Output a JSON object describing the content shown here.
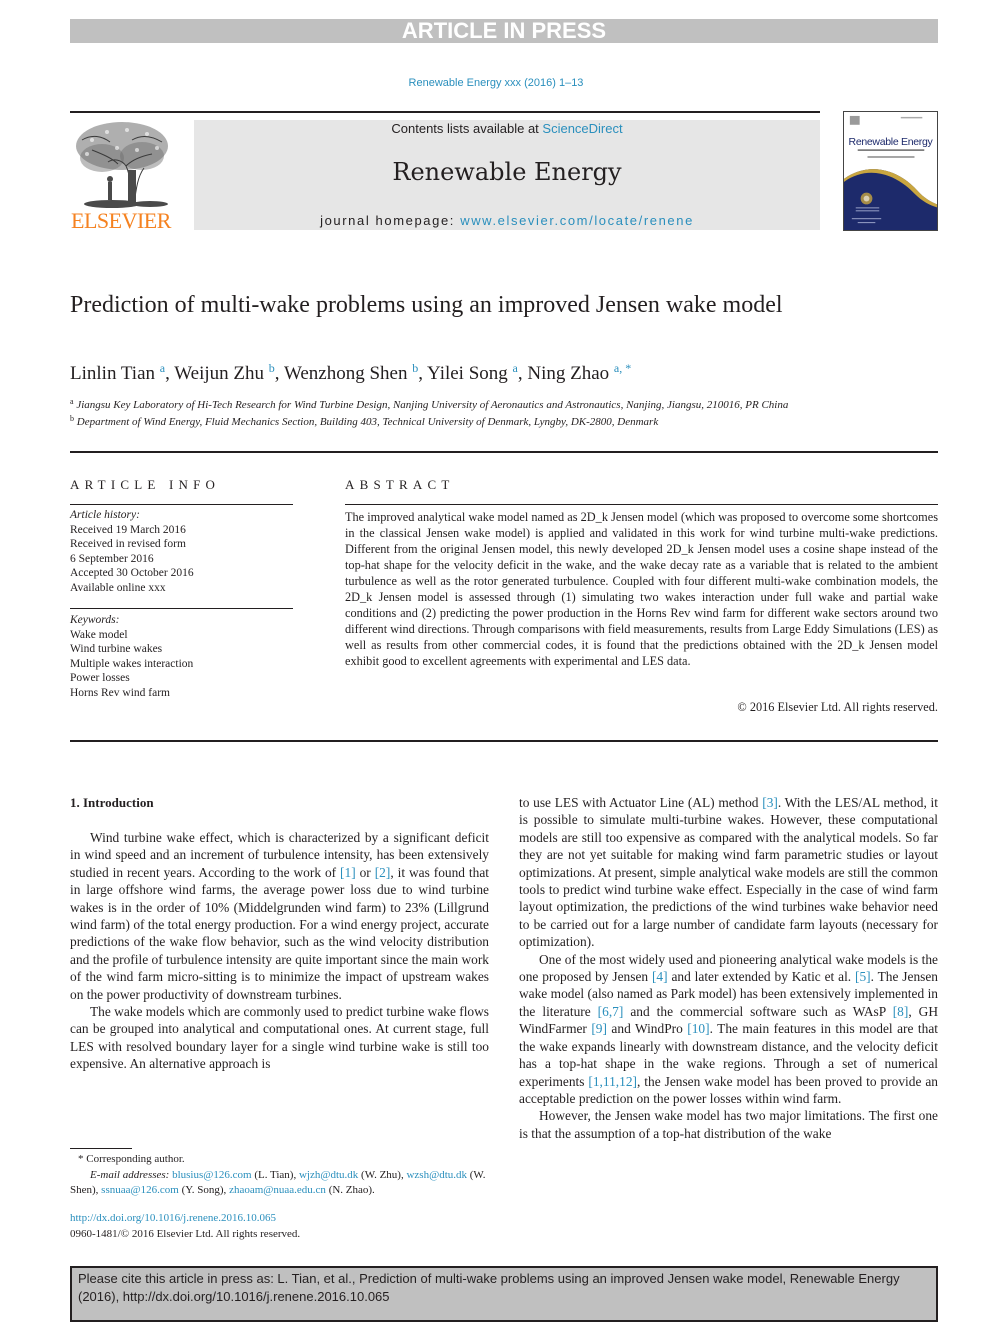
{
  "banner": "ARTICLE IN PRESS",
  "journal_ref": "Renewable Energy xxx (2016) 1–13",
  "masthead": {
    "contents_prefix": "Contents lists available at ",
    "contents_link": "ScienceDirect",
    "journal_name": "Renewable Energy",
    "homepage_prefix": "journal homepage: ",
    "homepage_link": "www.elsevier.com/locate/renene"
  },
  "publisher_logo": "ELSEVIER",
  "cover": {
    "title": "Renewable Energy",
    "subtitle": "AN INTERNATIONAL JOURNAL",
    "colors": {
      "navy": "#1d2a6b",
      "gold": "#c9a640"
    }
  },
  "article": {
    "title": "Prediction of multi-wake problems using an improved Jensen wake model",
    "authors": [
      {
        "name": "Linlin Tian",
        "affil": "a"
      },
      {
        "name": "Weijun Zhu",
        "affil": "b"
      },
      {
        "name": "Wenzhong Shen",
        "affil": "b"
      },
      {
        "name": "Yilei Song",
        "affil": "a"
      },
      {
        "name": "Ning Zhao",
        "affil": "a, *"
      }
    ],
    "affiliations": [
      {
        "mark": "a",
        "text": "Jiangsu Key Laboratory of Hi-Tech Research for Wind Turbine Design, Nanjing University of Aeronautics and Astronautics, Nanjing, Jiangsu, 210016, PR China"
      },
      {
        "mark": "b",
        "text": "Department of Wind Energy, Fluid Mechanics Section, Building 403, Technical University of Denmark, Lyngby, DK-2800, Denmark"
      }
    ]
  },
  "article_info": {
    "heading": "ARTICLE INFO",
    "history_label": "Article history:",
    "history": [
      "Received 19 March 2016",
      "Received in revised form",
      "6 September 2016",
      "Accepted 30 October 2016",
      "Available online xxx"
    ],
    "keywords_label": "Keywords:",
    "keywords": [
      "Wake model",
      "Wind turbine wakes",
      "Multiple wakes interaction",
      "Power losses",
      "Horns Rev wind farm"
    ]
  },
  "abstract": {
    "heading": "ABSTRACT",
    "text": "The improved analytical wake model named as 2D_k Jensen model (which was proposed to overcome some shortcomes in the classical Jensen wake model) is applied and validated in this work for wind turbine multi-wake predictions. Different from the original Jensen model, this newly developed 2D_k Jensen model uses a cosine shape instead of the top-hat shape for the velocity deficit in the wake, and the wake decay rate as a variable that is related to the ambient turbulence as well as the rotor generated turbulence. Coupled with four different multi-wake combination models, the 2D_k Jensen model is assessed through (1) simulating two wakes interaction under full wake and partial wake conditions and (2) predicting the power production in the Horns Rev wind farm for different wake sectors around two different wind directions. Through comparisons with field measurements, results from Large Eddy Simulations (LES) as well as results from other commercial codes, it is found that the predictions obtained with the 2D_k Jensen model exhibit good to excellent agreements with experimental and LES data.",
    "copyright": "© 2016 Elsevier Ltd. All rights reserved."
  },
  "body": {
    "section_heading": "1.  Introduction",
    "left": {
      "p1": [
        {
          "t": "Wind turbine wake effect, which is characterized by a significant deficit in wind speed and an increment of turbulence intensity, has been extensively studied in recent years. According to the work of "
        },
        {
          "ref": "[1]"
        },
        {
          "t": " or "
        },
        {
          "ref": "[2]"
        },
        {
          "t": ", it was found that in large offshore wind farms, the average power loss due to wind turbine wakes is in the order of 10% (Middelgrunden wind farm) to 23% (Lillgrund wind farm) of the total energy production. For a wind energy project, accurate predictions of the wake flow behavior, such as the wind velocity distribution and the profile of turbulence intensity are quite important since the main work of the wind farm micro-sitting is to minimize the impact of upstream wakes on the power productivity of downstream turbines."
        }
      ],
      "p2": "The wake models which are commonly used to predict turbine wake flows can be grouped into analytical and computational ones. At current stage, full LES with resolved boundary layer for a single wind turbine wake is still too expensive. An alternative approach is"
    },
    "right": {
      "p1": [
        {
          "t": "to use LES with Actuator Line (AL) method "
        },
        {
          "ref": "[3]"
        },
        {
          "t": ". With the LES/AL method, it is possible to simulate multi-turbine wakes. However, these computational models are still too expensive as compared with the analytical models. So far they are not yet suitable for making wind farm parametric studies or layout optimizations. At present, simple analytical wake models are still the common tools to predict wind turbine wake effect. Especially in the case of wind farm layout optimization, the predictions of the wind turbines wake behavior need to be carried out for a large number of candidate farm layouts (necessary for optimization)."
        }
      ],
      "p2": [
        {
          "t": "One of the most widely used and pioneering analytical wake models is the one proposed by Jensen "
        },
        {
          "ref": "[4]"
        },
        {
          "t": " and later extended by Katic et al. "
        },
        {
          "ref": "[5]"
        },
        {
          "t": ". The Jensen wake model (also named as Park model) has been extensively implemented in the literature "
        },
        {
          "ref": "[6,7]"
        },
        {
          "t": " and the commercial software such as WAsP "
        },
        {
          "ref": "[8]"
        },
        {
          "t": ", GH WindFarmer "
        },
        {
          "ref": "[9]"
        },
        {
          "t": " and WindPro "
        },
        {
          "ref": "[10]"
        },
        {
          "t": ". The main features in this model are that the wake expands linearly with downstream distance, and the velocity deficit has a top-hat shape in the wake regions. Through a set of numerical experiments "
        },
        {
          "ref": "[1,11,12]"
        },
        {
          "t": ", the Jensen wake model has been proved to provide an acceptable prediction on the power losses within wind farm."
        }
      ],
      "p3": "However, the Jensen wake model has two major limitations. The first one is that the assumption of a top-hat distribution of the wake"
    }
  },
  "footnotes": {
    "corresponding": "* Corresponding author.",
    "email_label": "E-mail addresses:",
    "emails": [
      {
        "addr": "blusius@126.com",
        "who": " (L. Tian), "
      },
      {
        "addr": "wjzh@dtu.dk",
        "who": " (W. Zhu), "
      },
      {
        "addr": "wzsh@dtu.dk",
        "who": " (W. Shen), "
      },
      {
        "addr": "ssnuaa@126.com",
        "who": " (Y. Song), "
      },
      {
        "addr": "zhaoam@nuaa.edu.cn",
        "who": " (N. Zhao)."
      }
    ],
    "doi": "http://dx.doi.org/10.1016/j.renene.2016.10.065",
    "issn_line": "0960-1481/© 2016 Elsevier Ltd. All rights reserved."
  },
  "cite_box": "Please cite this article in press as: L. Tian, et al., Prediction of multi-wake problems using an improved Jensen wake model, Renewable Energy (2016), http://dx.doi.org/10.1016/j.renene.2016.10.065"
}
